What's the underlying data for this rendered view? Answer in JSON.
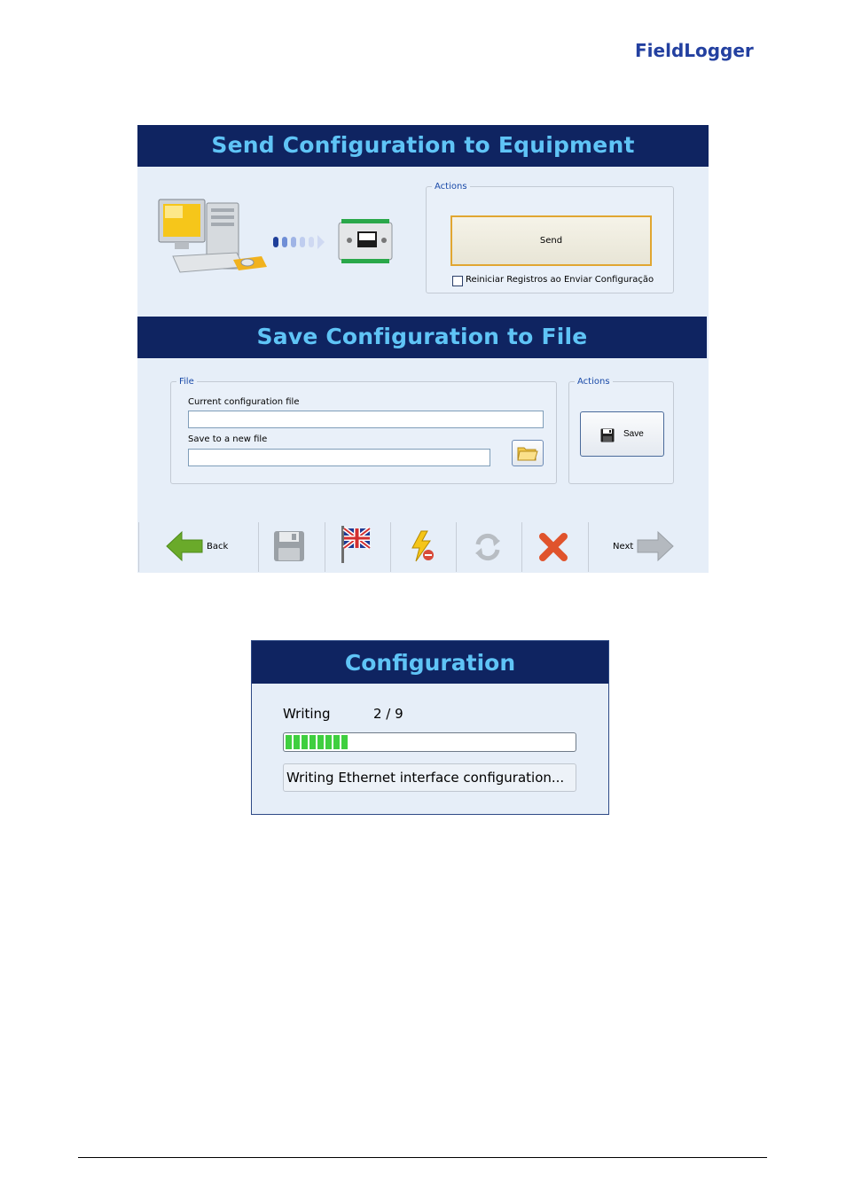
{
  "brand": {
    "logo_text": "FieldLogger",
    "color": "#2340a0"
  },
  "send_section": {
    "title": "Send Configuration to Equipment",
    "actions_legend": "Actions",
    "send_label": "Send",
    "reset_checkbox_label": "Reiniciar Registros ao Enviar Configuração",
    "reset_checked": false
  },
  "save_section": {
    "title": "Save Configuration to File",
    "file_legend": "File",
    "current_file_label": "Current configuration file",
    "current_file_value": "",
    "new_file_label": "Save to a new file",
    "new_file_value": "",
    "actions_legend": "Actions",
    "save_label": "Save"
  },
  "toolbar": {
    "back_label": "Back",
    "next_label": "Next",
    "icons": [
      "arrow-left-icon",
      "floppy-disk-icon",
      "uk-flag-icon",
      "lightning-icon",
      "refresh-icon",
      "close-icon",
      "arrow-right-icon"
    ]
  },
  "progress_dialog": {
    "title": "Configuration",
    "label": "Writing",
    "counter": "2 / 9",
    "progress_fraction": 0.22,
    "status": "Writing Ethernet interface configuration..."
  },
  "colors": {
    "banner_bg": "#0f2461",
    "banner_text": "#5fc4f6",
    "panel_bg": "#e6eef8",
    "send_border": "#e1a631",
    "progress_green": "#3fcf3f"
  }
}
